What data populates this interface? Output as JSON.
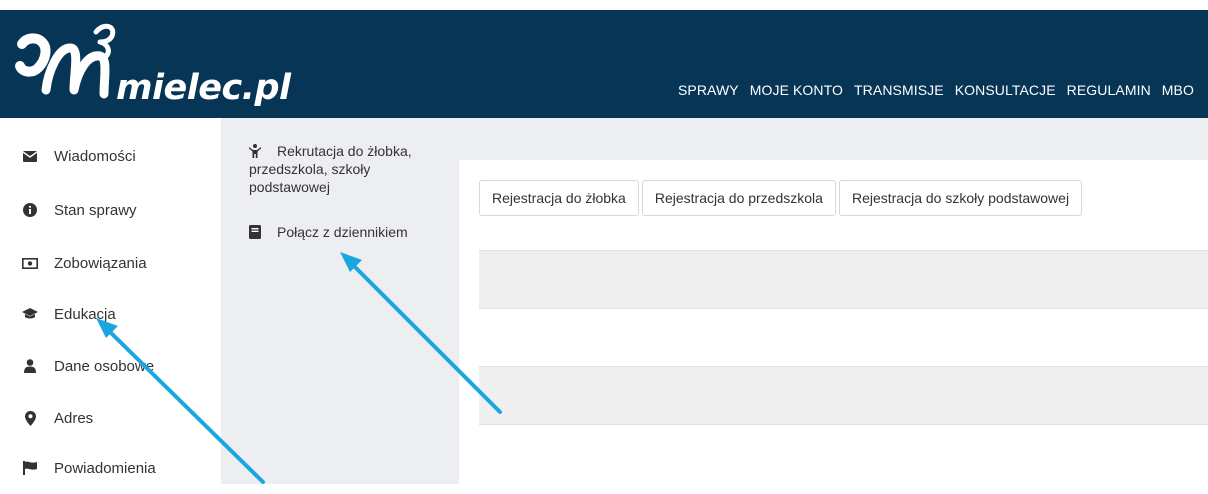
{
  "header": {
    "logo_text": "mielec.pl",
    "nav": [
      "SPRAWY",
      "MOJE KONTO",
      "TRANSMISJE",
      "KONSULTACJE",
      "REGULAMIN",
      "MBO"
    ]
  },
  "sidebar": {
    "items": [
      {
        "label": "Wiadomości",
        "icon": "envelope-icon"
      },
      {
        "label": "Stan sprawy",
        "icon": "info-circle-icon"
      },
      {
        "label": "Zobowiązania",
        "icon": "money-bill-icon"
      },
      {
        "label": "Edukacja",
        "icon": "graduation-cap-icon"
      },
      {
        "label": "Dane osobowe",
        "icon": "user-icon"
      },
      {
        "label": "Adres",
        "icon": "map-marker-icon"
      },
      {
        "label": "Powiadomienia",
        "icon": "flag-icon"
      }
    ]
  },
  "submenu": {
    "items": [
      {
        "label": "Rekrutacja do żłobka, przedszkola, szkoły podstawowej",
        "icon": "child-icon"
      },
      {
        "label": "Połącz z dziennikiem",
        "icon": "book-icon"
      }
    ]
  },
  "main": {
    "tabs": [
      "Rejestracja do żłobka",
      "Rejestracja do przedszkola",
      "Rejestracja do szkoły podstawowej"
    ]
  },
  "colors": {
    "header_bg": "#073555",
    "submenu_bg": "#eceef1",
    "annotation_arrow": "#1aa7e0"
  }
}
